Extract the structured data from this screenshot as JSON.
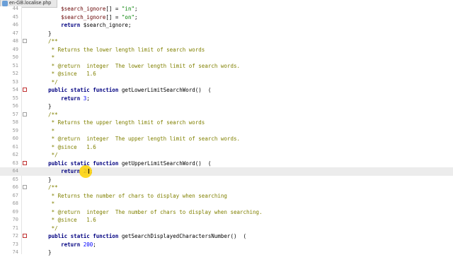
{
  "tab": {
    "title": "en-GB.localise.php"
  },
  "lines": [
    {
      "n": "44",
      "code": "        $search_ignore[] = \"in\";",
      "type": "var"
    },
    {
      "n": "45",
      "code": "        $search_ignore[] = \"on\";",
      "type": "var"
    },
    {
      "n": "46",
      "code": "        return $search_ignore;",
      "type": "plain"
    },
    {
      "n": "47",
      "code": "    }",
      "type": "plain"
    },
    {
      "n": "48",
      "code": "    /**",
      "type": "cm",
      "marker": "box"
    },
    {
      "n": "49",
      "code": "     * Returns the lower length limit of search words",
      "type": "cm"
    },
    {
      "n": "50",
      "code": "     *",
      "type": "cm"
    },
    {
      "n": "51",
      "code": "     * @return  integer  The lower length limit of search words.",
      "type": "cm"
    },
    {
      "n": "52",
      "code": "     * @since   1.6",
      "type": "cm"
    },
    {
      "n": "53",
      "code": "     */",
      "type": "cm"
    },
    {
      "n": "54",
      "code": "    public static function getLowerLimitSearchWord()  (",
      "type": "kw",
      "marker": "red"
    },
    {
      "n": "55",
      "code": "        return 3;",
      "type": "plain"
    },
    {
      "n": "56",
      "code": "    }",
      "type": "plain"
    },
    {
      "n": "57",
      "code": "    /**",
      "type": "cm",
      "marker": "box"
    },
    {
      "n": "58",
      "code": "     * Returns the upper length limit of search words",
      "type": "cm"
    },
    {
      "n": "59",
      "code": "     *",
      "type": "cm"
    },
    {
      "n": "60",
      "code": "     * @return  integer  The upper length limit of search words.",
      "type": "cm"
    },
    {
      "n": "61",
      "code": "     * @since   1.6",
      "type": "cm"
    },
    {
      "n": "62",
      "code": "     */",
      "type": "cm"
    },
    {
      "n": "63",
      "code": "    public static function getUpperLimitSearchWord()  (",
      "type": "kw",
      "marker": "red"
    },
    {
      "n": "64",
      "code": "        return 20;",
      "type": "plain",
      "current": true
    },
    {
      "n": "65",
      "code": "    }",
      "type": "plain"
    },
    {
      "n": "66",
      "code": "    /**",
      "type": "cm",
      "marker": "box"
    },
    {
      "n": "67",
      "code": "     * Returns the number of chars to display when searching",
      "type": "cm"
    },
    {
      "n": "68",
      "code": "     *",
      "type": "cm"
    },
    {
      "n": "69",
      "code": "     * @return  integer  The number of chars to display when searching.",
      "type": "cm"
    },
    {
      "n": "70",
      "code": "     * @since   1.6",
      "type": "cm"
    },
    {
      "n": "71",
      "code": "     */",
      "type": "cm"
    },
    {
      "n": "72",
      "code": "    public static function getSearchDisplayedCharactersNumber()  (",
      "type": "kw",
      "marker": "red"
    },
    {
      "n": "73",
      "code": "        return 200;",
      "type": "plain"
    },
    {
      "n": "74",
      "code": "    }",
      "type": "plain"
    }
  ]
}
